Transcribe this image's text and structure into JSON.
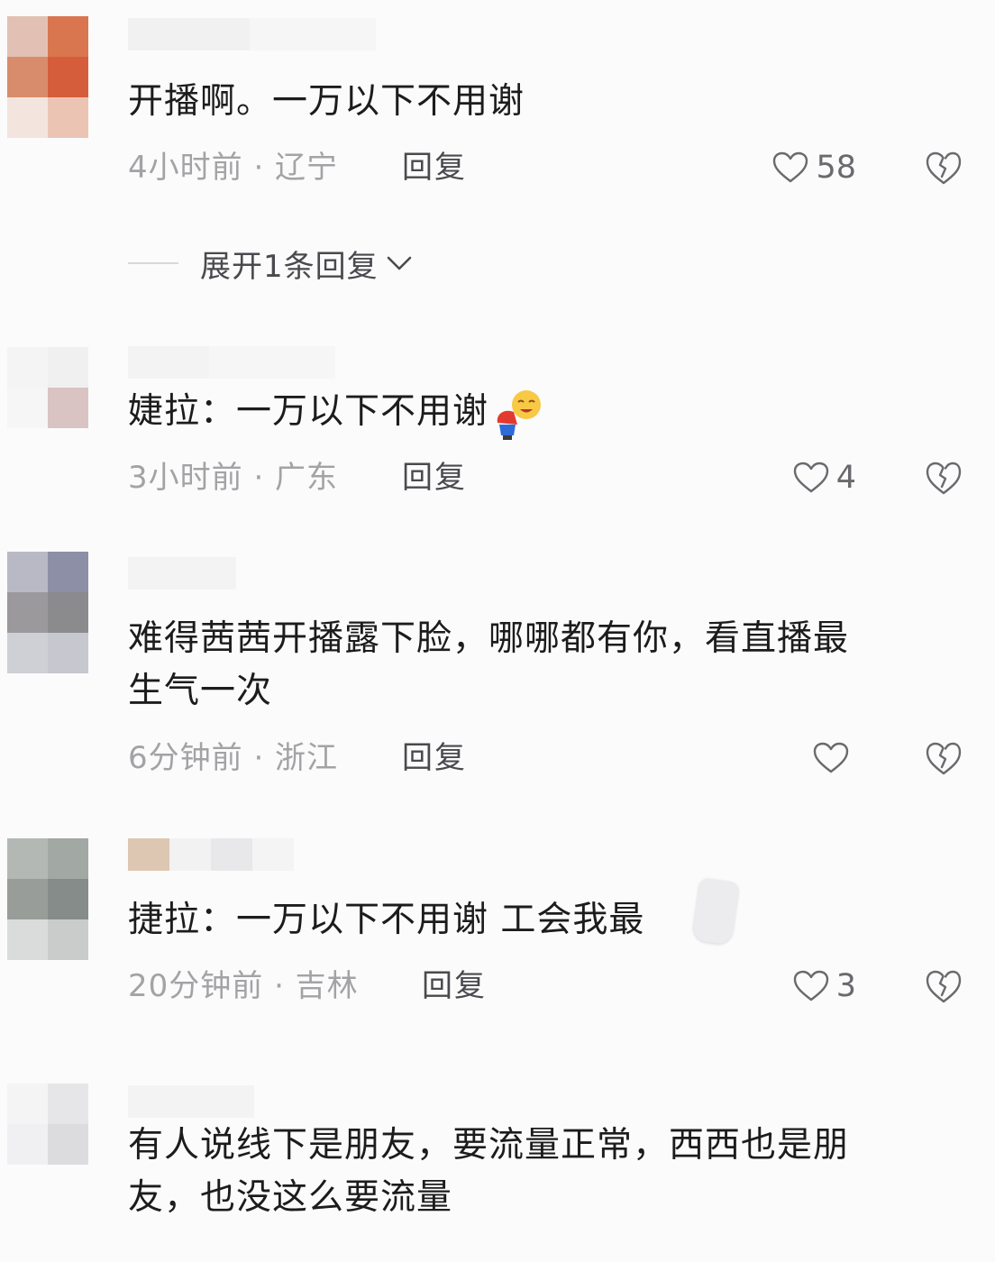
{
  "comments": [
    {
      "text": "开播啊。一万以下不用谢",
      "time_location": "4小时前 · 辽宁",
      "reply_label": "回复",
      "likes": "58",
      "expand_label": "展开1条回复"
    },
    {
      "text": "婕拉：一万以下不用谢",
      "time_location": "3小时前 · 广东",
      "reply_label": "回复",
      "likes": "4"
    },
    {
      "text_line1": "难得茜茜开播露下脸，哪哪都有你，看直播最",
      "text_line2": "生气一次",
      "time_location": "6分钟前 · 浙江",
      "reply_label": "回复",
      "likes": ""
    },
    {
      "text": "捷拉：一万以下不用谢 工会我最",
      "time_location": "20分钟前 · 吉林",
      "reply_label": "回复",
      "likes": "3"
    },
    {
      "text_line1": "有人说线下是朋友，要流量正常，西西也是朋",
      "text_line2": "友，也没这么要流量"
    }
  ],
  "icons": {
    "like": "heart-outline-icon",
    "dislike": "broken-heart-icon",
    "expand": "chevron-down-icon",
    "sticker": "laughing-emoji-sticker"
  },
  "colors": {
    "text": "#1c1c1c",
    "meta": "#a3a3a6",
    "action": "#4a4a4e"
  }
}
